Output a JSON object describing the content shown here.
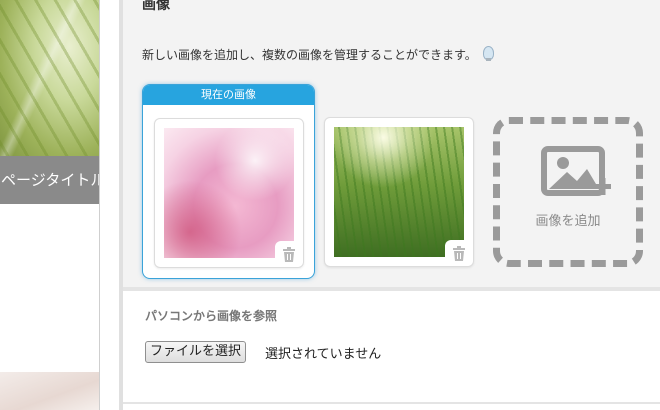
{
  "sidebar": {
    "page_title": "ページタイトル"
  },
  "image_section": {
    "heading": "画像",
    "description": "新しい画像を追加し、複数の画像を管理することができます。",
    "current_label": "現在の画像",
    "add_label": "画像を追加"
  },
  "upload": {
    "title": "パソコンから画像を参照",
    "button_label": "ファイルを選択",
    "status": "選択されていません"
  },
  "colors": {
    "accent": "#27a4df",
    "panel_bg": "#f3f3f3",
    "sidebar_title_bg": "#8a8a8a"
  }
}
